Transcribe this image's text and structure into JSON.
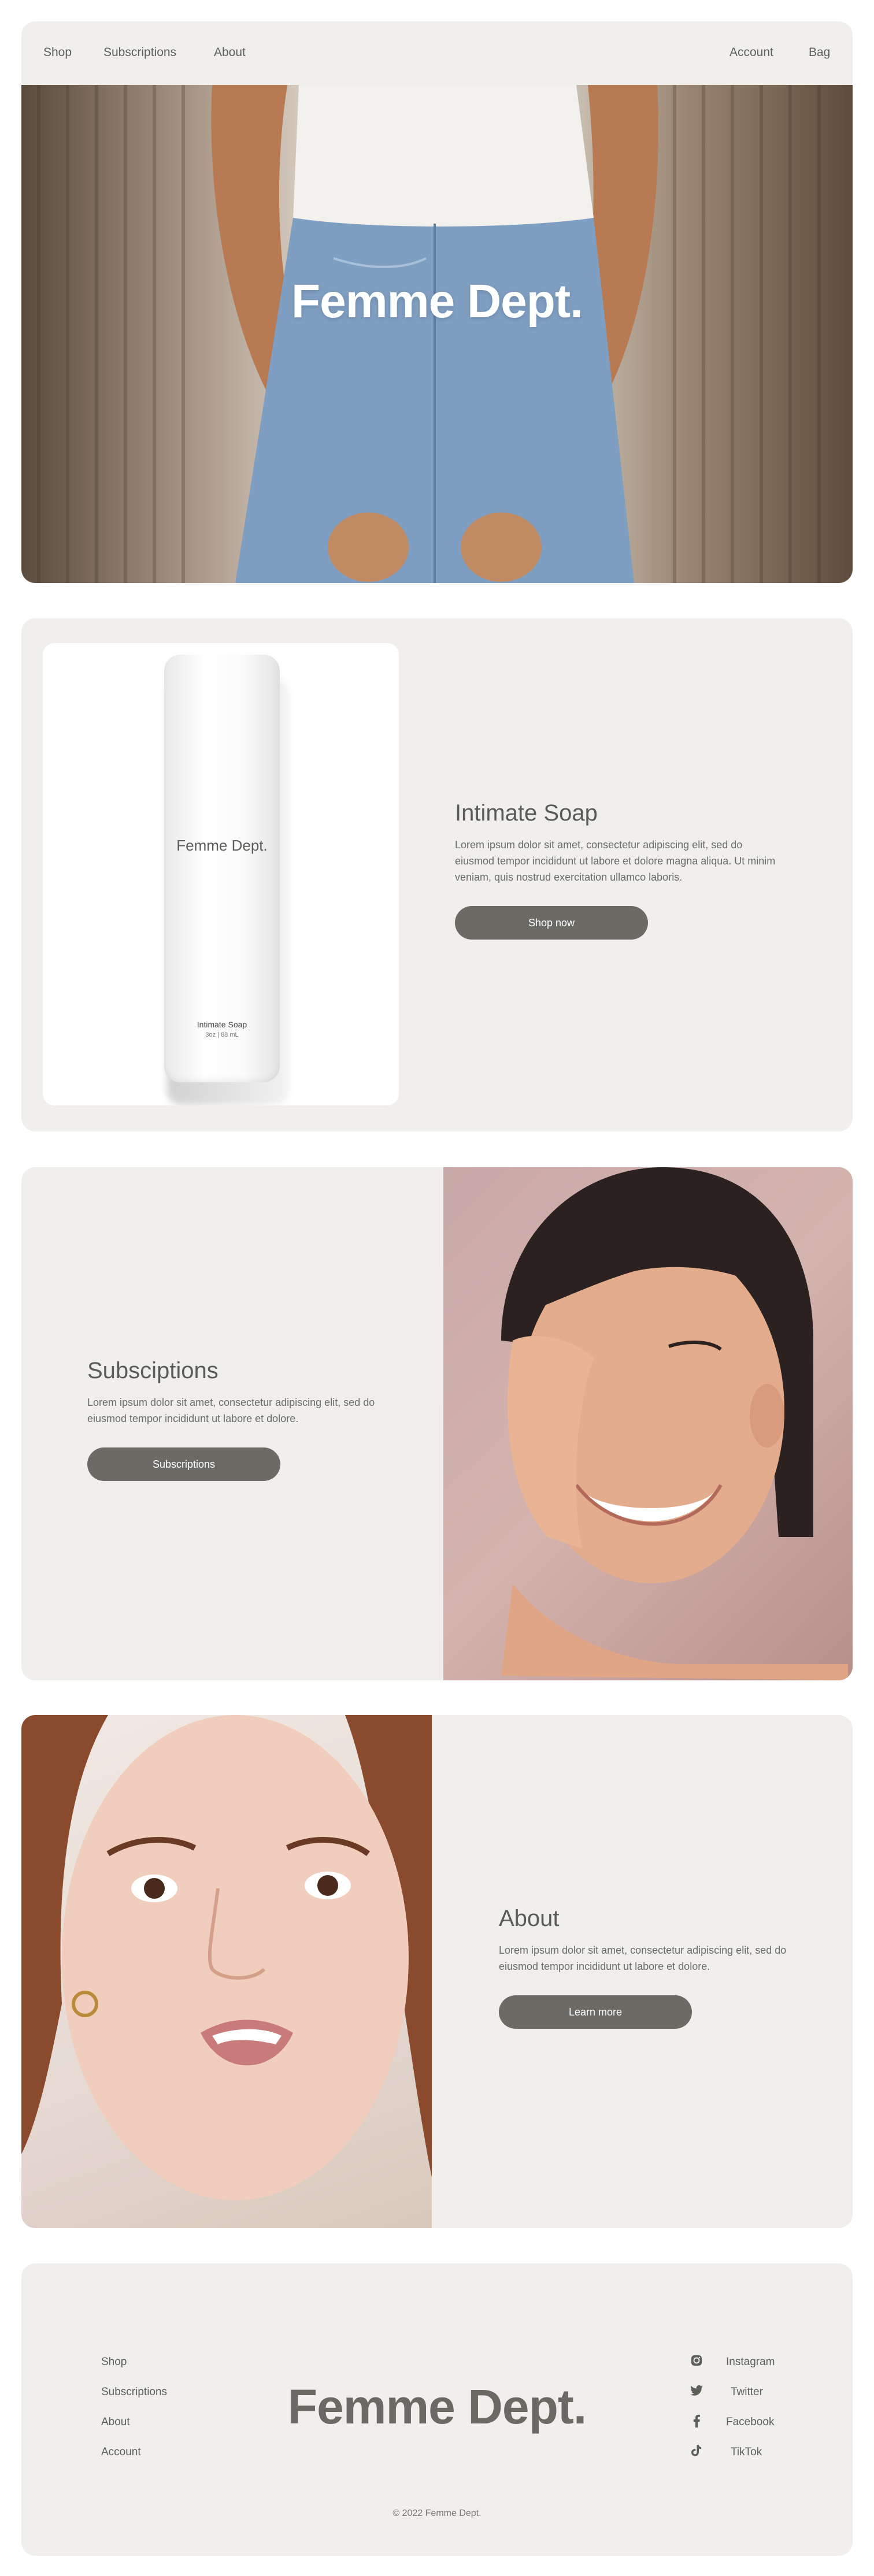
{
  "nav": {
    "left": [
      "Shop",
      "Subscriptions",
      "About"
    ],
    "right": [
      "Account",
      "Bag"
    ]
  },
  "hero": {
    "title": "Femme Dept."
  },
  "product": {
    "bottle_brand": "Femme Dept.",
    "bottle_label": "Intimate Soap",
    "bottle_sub": "3oz | 88 mL",
    "heading": "Intimate Soap",
    "body": "Lorem ipsum dolor sit amet, consectetur adipiscing elit, sed do eiusmod tempor incididunt ut labore et dolore magna aliqua. Ut minim veniam, quis nostrud exercitation ullamco laboris.",
    "button": "Shop now"
  },
  "subscriptions": {
    "heading": "Subsciptions",
    "body": "Lorem ipsum dolor sit amet, consectetur adipiscing elit, sed do eiusmod tempor incididunt ut labore et dolore.",
    "button": "Subscriptions"
  },
  "about": {
    "heading": "About",
    "body": "Lorem ipsum dolor sit amet, consectetur adipiscing elit, sed do eiusmod tempor incididunt ut labore et dolore.",
    "button": "Learn more"
  },
  "footer": {
    "links": [
      "Shop",
      "Subscriptions",
      "About",
      "Account"
    ],
    "brand": "Femme Dept.",
    "social": [
      {
        "label": "Instagram",
        "icon": "instagram-icon"
      },
      {
        "label": "Twitter",
        "icon": "twitter-icon"
      },
      {
        "label": "Facebook",
        "icon": "facebook-icon"
      },
      {
        "label": "TikTok",
        "icon": "tiktok-icon"
      }
    ],
    "copyright": "© 2022 Femme Dept."
  }
}
